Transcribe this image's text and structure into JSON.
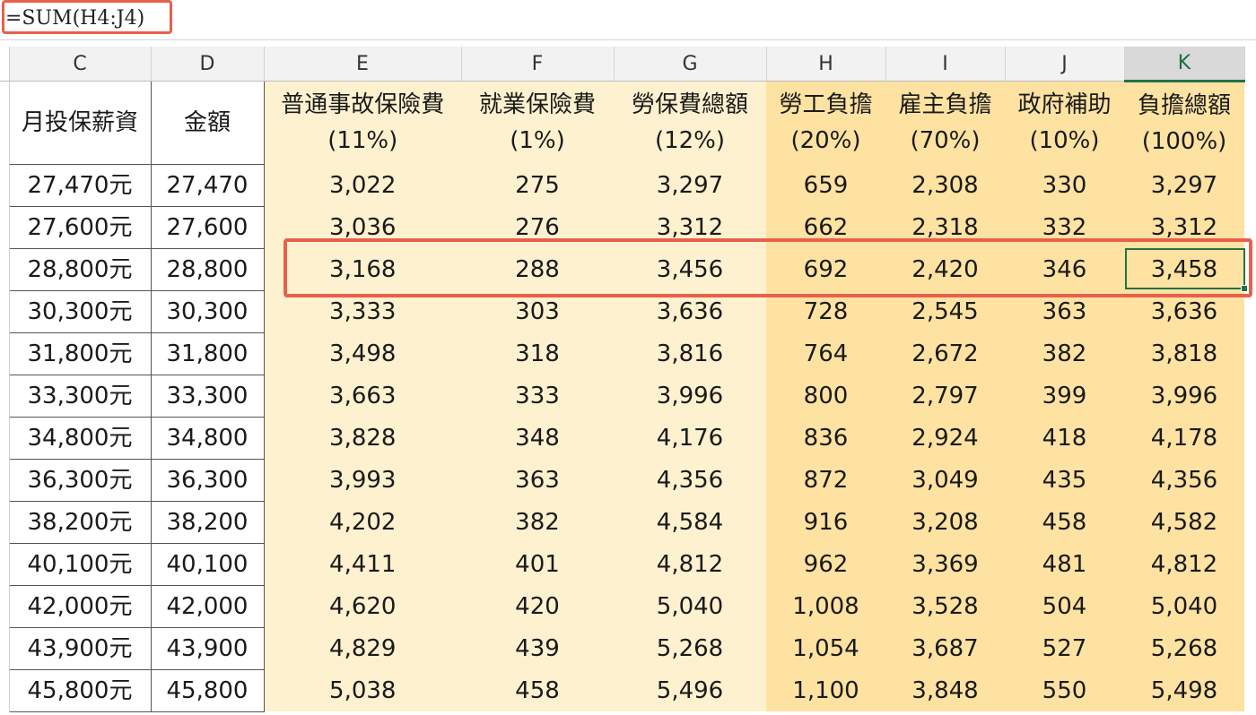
{
  "formula_bar": {
    "text": "=SUM(H4:J4)"
  },
  "columns": [
    "C",
    "D",
    "E",
    "F",
    "G",
    "H",
    "I",
    "J",
    "K"
  ],
  "active_column": "K",
  "headers": {
    "C": {
      "line1": "月投保薪資",
      "line2": ""
    },
    "D": {
      "line1": "金額",
      "line2": ""
    },
    "E": {
      "line1": "普通事故保險費",
      "line2": "(11%)"
    },
    "F": {
      "line1": "就業保險費",
      "line2": "(1%)"
    },
    "G": {
      "line1": "勞保費總額",
      "line2": "(12%)"
    },
    "H": {
      "line1": "勞工負擔",
      "line2": "(20%)"
    },
    "I": {
      "line1": "雇主負擔",
      "line2": "(70%)"
    },
    "J": {
      "line1": "政府補助",
      "line2": "(10%)"
    },
    "K": {
      "line1": "負擔總額",
      "line2": "(100%)"
    }
  },
  "rows": [
    [
      "27,470元",
      "27,470",
      "3,022",
      "275",
      "3,297",
      "659",
      "2,308",
      "330",
      "3,297"
    ],
    [
      "27,600元",
      "27,600",
      "3,036",
      "276",
      "3,312",
      "662",
      "2,318",
      "332",
      "3,312"
    ],
    [
      "28,800元",
      "28,800",
      "3,168",
      "288",
      "3,456",
      "692",
      "2,420",
      "346",
      "3,458"
    ],
    [
      "30,300元",
      "30,300",
      "3,333",
      "303",
      "3,636",
      "728",
      "2,545",
      "363",
      "3,636"
    ],
    [
      "31,800元",
      "31,800",
      "3,498",
      "318",
      "3,816",
      "764",
      "2,672",
      "382",
      "3,818"
    ],
    [
      "33,300元",
      "33,300",
      "3,663",
      "333",
      "3,996",
      "800",
      "2,797",
      "399",
      "3,996"
    ],
    [
      "34,800元",
      "34,800",
      "3,828",
      "348",
      "4,176",
      "836",
      "2,924",
      "418",
      "4,178"
    ],
    [
      "36,300元",
      "36,300",
      "3,993",
      "363",
      "4,356",
      "872",
      "3,049",
      "435",
      "4,356"
    ],
    [
      "38,200元",
      "38,200",
      "4,202",
      "382",
      "4,584",
      "916",
      "3,208",
      "458",
      "4,582"
    ],
    [
      "40,100元",
      "40,100",
      "4,411",
      "401",
      "4,812",
      "962",
      "3,369",
      "481",
      "4,812"
    ],
    [
      "42,000元",
      "42,000",
      "4,620",
      "420",
      "5,040",
      "1,008",
      "3,528",
      "504",
      "5,040"
    ],
    [
      "43,900元",
      "43,900",
      "4,829",
      "439",
      "5,268",
      "1,054",
      "3,687",
      "527",
      "5,268"
    ],
    [
      "45,800元",
      "45,800",
      "5,038",
      "458",
      "5,496",
      "1,100",
      "3,848",
      "550",
      "5,498"
    ]
  ],
  "colors": {
    "light_band": "#fdf1cf",
    "dark_band": "#fde2a2",
    "highlight": "#e8604c",
    "selection": "#217346"
  }
}
